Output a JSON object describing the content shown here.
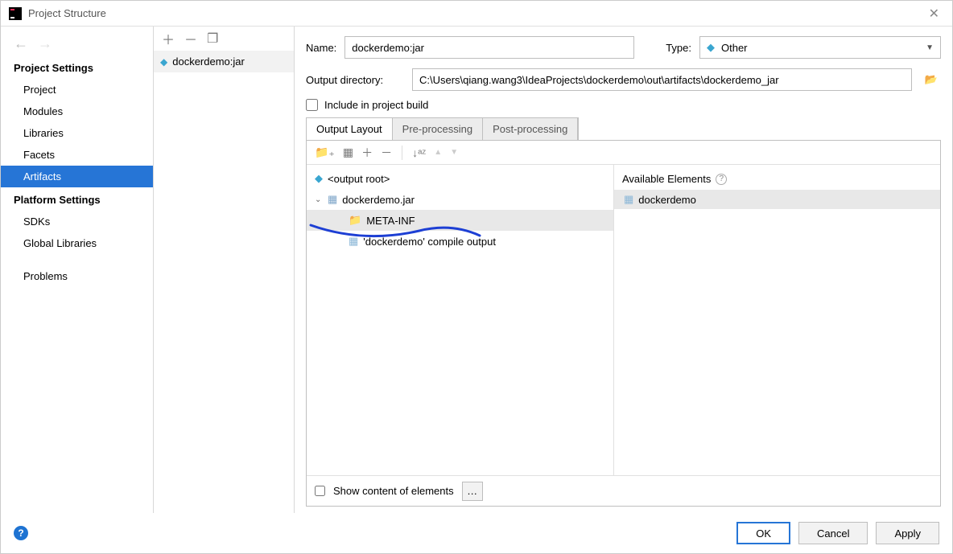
{
  "window": {
    "title": "Project Structure"
  },
  "sidebar": {
    "section_project": "Project Settings",
    "section_platform": "Platform Settings",
    "items": {
      "project": "Project",
      "modules": "Modules",
      "libraries": "Libraries",
      "facets": "Facets",
      "artifacts": "Artifacts",
      "sdks": "SDKs",
      "global_libraries": "Global Libraries",
      "problems": "Problems"
    }
  },
  "artifact_list": {
    "items": [
      {
        "label": "dockerdemo:jar"
      }
    ]
  },
  "form": {
    "name_label": "Name:",
    "name_value": "dockerdemo:jar",
    "type_label": "Type:",
    "type_value": "Other",
    "output_dir_label": "Output directory:",
    "output_dir_value": "C:\\Users\\qiang.wang3\\IdeaProjects\\dockerdemo\\out\\artifacts\\dockerdemo_jar",
    "include_build_label": "Include in project build"
  },
  "tabs": {
    "output_layout": "Output Layout",
    "pre_processing": "Pre-processing",
    "post_processing": "Post-processing"
  },
  "output_layout": {
    "tree": {
      "root": "<output root>",
      "jar": "dockerdemo.jar",
      "meta_inf": "META-INF",
      "compile_output": "'dockerdemo' compile output"
    },
    "available_header": "Available Elements",
    "available_items": [
      {
        "label": "dockerdemo"
      }
    ],
    "footer_label": "Show content of elements"
  },
  "buttons": {
    "ok": "OK",
    "cancel": "Cancel",
    "apply": "Apply"
  },
  "icons": {
    "plus": "＋",
    "minus": "－",
    "copy": "❐",
    "sort": "↓ᵃᶻ",
    "up": "▲",
    "down": "▼",
    "chevron_down": "▼",
    "tree_expanded": "⌄",
    "diamond": "◆",
    "folder": "📁",
    "module": "▦",
    "browse": "📂",
    "help_q": "?"
  }
}
